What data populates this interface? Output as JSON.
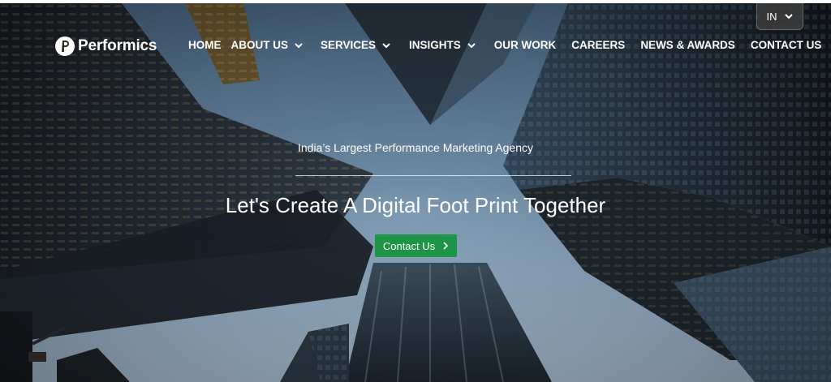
{
  "brand": {
    "name": "Performics"
  },
  "nav": {
    "items": [
      {
        "label": "HOME",
        "dropdown": false
      },
      {
        "label": "ABOUT US",
        "dropdown": true
      },
      {
        "label": "SERVICES",
        "dropdown": true
      },
      {
        "label": "INSIGHTS",
        "dropdown": true
      },
      {
        "label": "OUR WORK",
        "dropdown": false
      },
      {
        "label": "CAREERS",
        "dropdown": false
      },
      {
        "label": "NEWS & AWARDS",
        "dropdown": false
      },
      {
        "label": "CONTACT US",
        "dropdown": false
      }
    ]
  },
  "language": {
    "selected": "IN"
  },
  "hero": {
    "tagline": "India’s Largest Performance Marketing Agency",
    "headline": "Let's Create A Digital Foot Print Together",
    "cta_label": "Contact Us"
  },
  "colors": {
    "cta": "#1e9447",
    "text": "#ffffff"
  }
}
